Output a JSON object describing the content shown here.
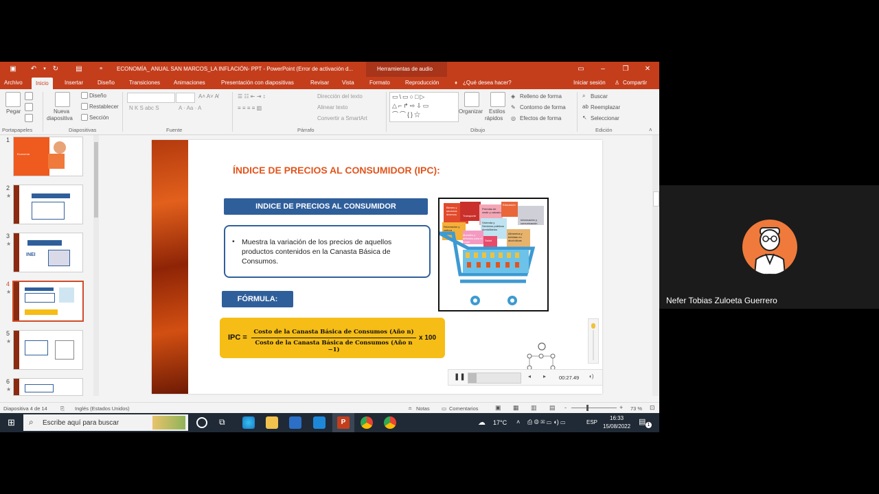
{
  "titlebar": {
    "doc_title": "ECONOMÍA_ ANUAL SAN MARCOS_LA INFLACIÓN- PPT - PowerPoint (Error de activación d...",
    "context_tab": "Herramientas de audio"
  },
  "tabs": [
    {
      "label": "Archivo"
    },
    {
      "label": "Inicio"
    },
    {
      "label": "Insertar"
    },
    {
      "label": "Diseño"
    },
    {
      "label": "Transiciones"
    },
    {
      "label": "Animaciones"
    },
    {
      "label": "Presentación con diapositivas"
    },
    {
      "label": "Revisar"
    },
    {
      "label": "Vista"
    },
    {
      "label": "Formato"
    },
    {
      "label": "Reproducción"
    }
  ],
  "tell_me": "¿Qué desea hacer?",
  "signin": "Iniciar sesión",
  "share": "Compartir",
  "ribbon": {
    "paste": "Pegar",
    "clipboard_group": "Portapapeles",
    "new_slide_1": "Nueva",
    "new_slide_2": "diapositiva",
    "layout": "Diseño",
    "reset": "Restablecer",
    "section": "Sección",
    "slides_group": "Diapositivas",
    "font_group": "Fuente",
    "font_buttons": "N  K  S  abc  S",
    "text_direction": "Dirección del texto",
    "align_text": "Alinear texto",
    "smartart": "Convertir a SmartArt",
    "paragraph_group": "Párrafo",
    "arrange": "Organizar",
    "quick_styles_1": "Estilos",
    "quick_styles_2": "rápidos",
    "shape_fill": "Relleno de forma",
    "shape_outline": "Contorno de forma",
    "shape_effects": "Efectos de forma",
    "drawing_group": "Dibujo",
    "find": "Buscar",
    "replace": "Reemplazar",
    "select": "Seleccionar",
    "editing_group": "Edición"
  },
  "thumbnails": [
    {
      "num": "1",
      "star": ""
    },
    {
      "num": "2",
      "star": "★"
    },
    {
      "num": "3",
      "star": "★"
    },
    {
      "num": "4",
      "star": "★"
    },
    {
      "num": "5",
      "star": "★"
    },
    {
      "num": "6",
      "star": "★"
    }
  ],
  "thumb1_name": "Economía",
  "thumb3_logo": "INEI",
  "slide": {
    "title": "ÍNDICE DE PRECIOS AL CONSUMIDOR (IPC):",
    "header": "INDICE DE PRECIOS AL CONSUMIDOR",
    "bullet": "Muestra la variación de los precios de aquellos productos contenidos en la Canasta Básica de Consumos.",
    "formula_label": "FÓRMULA:",
    "formula_lhs": "IPC =",
    "formula_numerator": "Costo de la Canasta Básica de Consumos (Año n)",
    "formula_denominator": "Costo de la Canasta Básica de Consumos (Año n −1)",
    "formula_multiplier": "x 100",
    "cart_labels": {
      "food": "Bienes y servicios diversos",
      "transport": "Transporte",
      "clothes": "Prendas de vestir y calzado",
      "education": "Educación",
      "info": "Información y comunicación",
      "recreation": "Recreación y cultura",
      "housing": "Vivienda y Servicios públicos domiciliarios",
      "furniture": "Muebles y artículos para el hogar",
      "health": "Salud",
      "food2": "Alimentos y bebidas no alcohólicas"
    }
  },
  "player": {
    "time": "00:27.49"
  },
  "status": {
    "slide_of": "Diapositiva 4 de 14",
    "language": "Inglés (Estados Unidos)",
    "notes": "Notas",
    "comments": "Comentarios",
    "zoom": "73 %"
  },
  "taskbar": {
    "search_placeholder": "Escribe aquí para buscar",
    "temperature": "17°C",
    "lang": "ESP",
    "time": "16:33",
    "date": "15/08/2022",
    "notif_count": "1"
  },
  "participant": {
    "name": "Nefer Tobias Zuloeta Guerrero"
  },
  "colors": {
    "ppt_red": "#c43e1c",
    "slide_title": "#e2541c",
    "blue": "#2f5f9b",
    "formula_yellow": "#f6bd16"
  }
}
